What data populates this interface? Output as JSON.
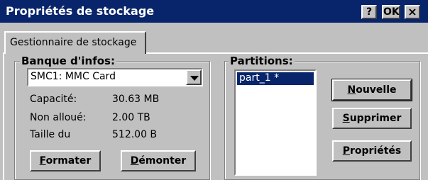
{
  "window": {
    "title": "Propriétés de stockage",
    "help_label": "?",
    "ok_label": "OK",
    "close_label": "×"
  },
  "tab": {
    "label": "Gestionnaire de stockage"
  },
  "info_bank": {
    "legend": "Banque d'infos:",
    "card_select": {
      "value": "SMC1: MMC Card"
    },
    "rows": [
      {
        "label": "Capacité:",
        "value": "30.63 MB"
      },
      {
        "label": "Non alloué:",
        "value": "2.00 TB"
      },
      {
        "label": "Taille du",
        "value": "512.00 B"
      }
    ],
    "format_button": {
      "mnemonic": "F",
      "rest": "ormater"
    },
    "unmount_button": {
      "mnemonic": "D",
      "rest": "émonter"
    }
  },
  "partitions": {
    "legend": "Partitions:",
    "items": [
      {
        "label": "part_1 *",
        "selected": true
      }
    ],
    "new_button": {
      "mnemonic": "N",
      "rest": "ouvelle"
    },
    "delete_button": {
      "mnemonic": "S",
      "rest": "upprimer"
    },
    "properties_button": {
      "mnemonic": "P",
      "rest": "ropriétés"
    }
  },
  "colors": {
    "title_bar": "#08246b",
    "face": "#c0c0c0",
    "selection": "#08246b"
  }
}
